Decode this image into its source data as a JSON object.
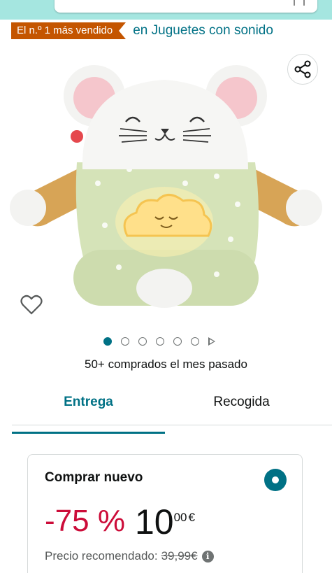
{
  "bestseller": {
    "badge_label": "El n.º 1 más vendido",
    "category_link": "en Juguetes con sonido"
  },
  "icons": {
    "share": "share-icon",
    "heart": "heart-icon",
    "info": "info-icon",
    "play": "play-icon",
    "mic": "mic-icon"
  },
  "carousel": {
    "total_dots": 6,
    "active_index": 0
  },
  "social_proof": {
    "bought_text": "50+ comprados el mes pasado"
  },
  "tabs": [
    {
      "label": "Entrega",
      "active": true
    },
    {
      "label": "Recogida",
      "active": false
    }
  ],
  "buy_box": {
    "title": "Comprar nuevo",
    "discount": "-75 %",
    "price_whole": "10",
    "price_fraction": "00",
    "currency": "€",
    "rrp_label": "Precio recomendado:",
    "rrp_value": "39,99€",
    "info_glyph": "i"
  },
  "colors": {
    "accent": "#007185",
    "badge": "#c45500",
    "discount": "#cc0c39",
    "header": "#a5e6e0"
  }
}
